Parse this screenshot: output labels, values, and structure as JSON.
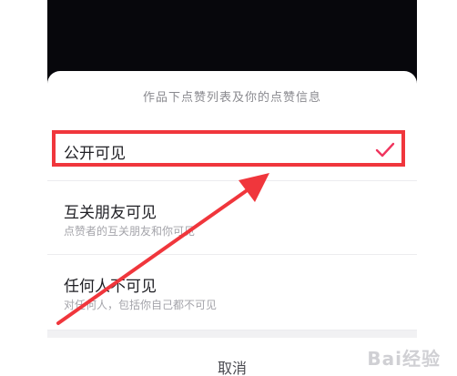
{
  "sheet": {
    "title": "作品下点赞列表及你的点赞信息",
    "options": [
      {
        "label": "公开可见",
        "sublabel": "",
        "selected": true
      },
      {
        "label": "互关朋友可见",
        "sublabel": "点赞者的互关朋友和你可见",
        "selected": false
      },
      {
        "label": "任何人不可见",
        "sublabel": "对任何人，包括你自己都不可见",
        "selected": false
      }
    ],
    "cancel_label": "取消"
  },
  "colors": {
    "accent_check": "#f0355e",
    "annotation_red": "#f0363c",
    "phone_background": "#07070c"
  },
  "icons": {
    "selected": "check-icon",
    "annotation_arrow": "arrow-icon"
  },
  "watermark": {
    "text": "Bai经验"
  }
}
